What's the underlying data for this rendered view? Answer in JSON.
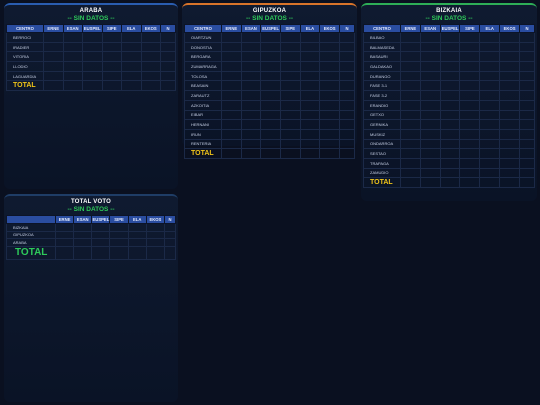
{
  "columns": [
    "CENTRO",
    "ERNE",
    "ESAN",
    "EUSPEL",
    "SIPE",
    "ELA",
    "EKOS",
    "N"
  ],
  "no_data_label": "-- SIN DATOS --",
  "panels": {
    "araba": {
      "title": "ARABA",
      "rows": [
        "BERROCI",
        "IRADIER",
        "VITORIA",
        "LLODIO",
        "LAGUARDIA"
      ],
      "total_label": "TOTAL",
      "accent_color": "#2a5db0"
    },
    "gipuzkoa": {
      "title": "GIPUZKOA",
      "rows": [
        "OIARTZUN",
        "DONOSTIA",
        "BERGARA",
        "ZUMARRAGA",
        "TOLOSA",
        "BEASAIN",
        "ZARAUTZ",
        "AZKOITIA",
        "EIBAR",
        "HERNANI",
        "IRUN",
        "RENTERIA"
      ],
      "total_label": "TOTAL",
      "accent_color": "#d9742a"
    },
    "bizkaia": {
      "title": "BIZKAIA",
      "rows": [
        "BILBAO",
        "BALMASEDA",
        "BASAURI",
        "GALDAKAO",
        "DURANGO",
        "FASE 3-1",
        "FASE 3-2",
        "ERANDIO",
        "GETXO",
        "GERNIKA",
        "MUSKIZ",
        "ONDARROA",
        "SESTAO",
        "TRAPAGA",
        "ZAMUDIO"
      ],
      "total_label": "TOTAL",
      "accent_color": "#2eae57"
    },
    "total_voto": {
      "title": "TOTAL VOTO",
      "rows": [
        "BIZKAIA",
        "GIPUZKOA",
        "ARABA"
      ],
      "total_label": "TOTAL"
    }
  },
  "colors": {
    "header_bg": "#2a4da0",
    "no_data": "#2ec95a",
    "total_text": "#f0c419",
    "background": "#0a1020"
  }
}
